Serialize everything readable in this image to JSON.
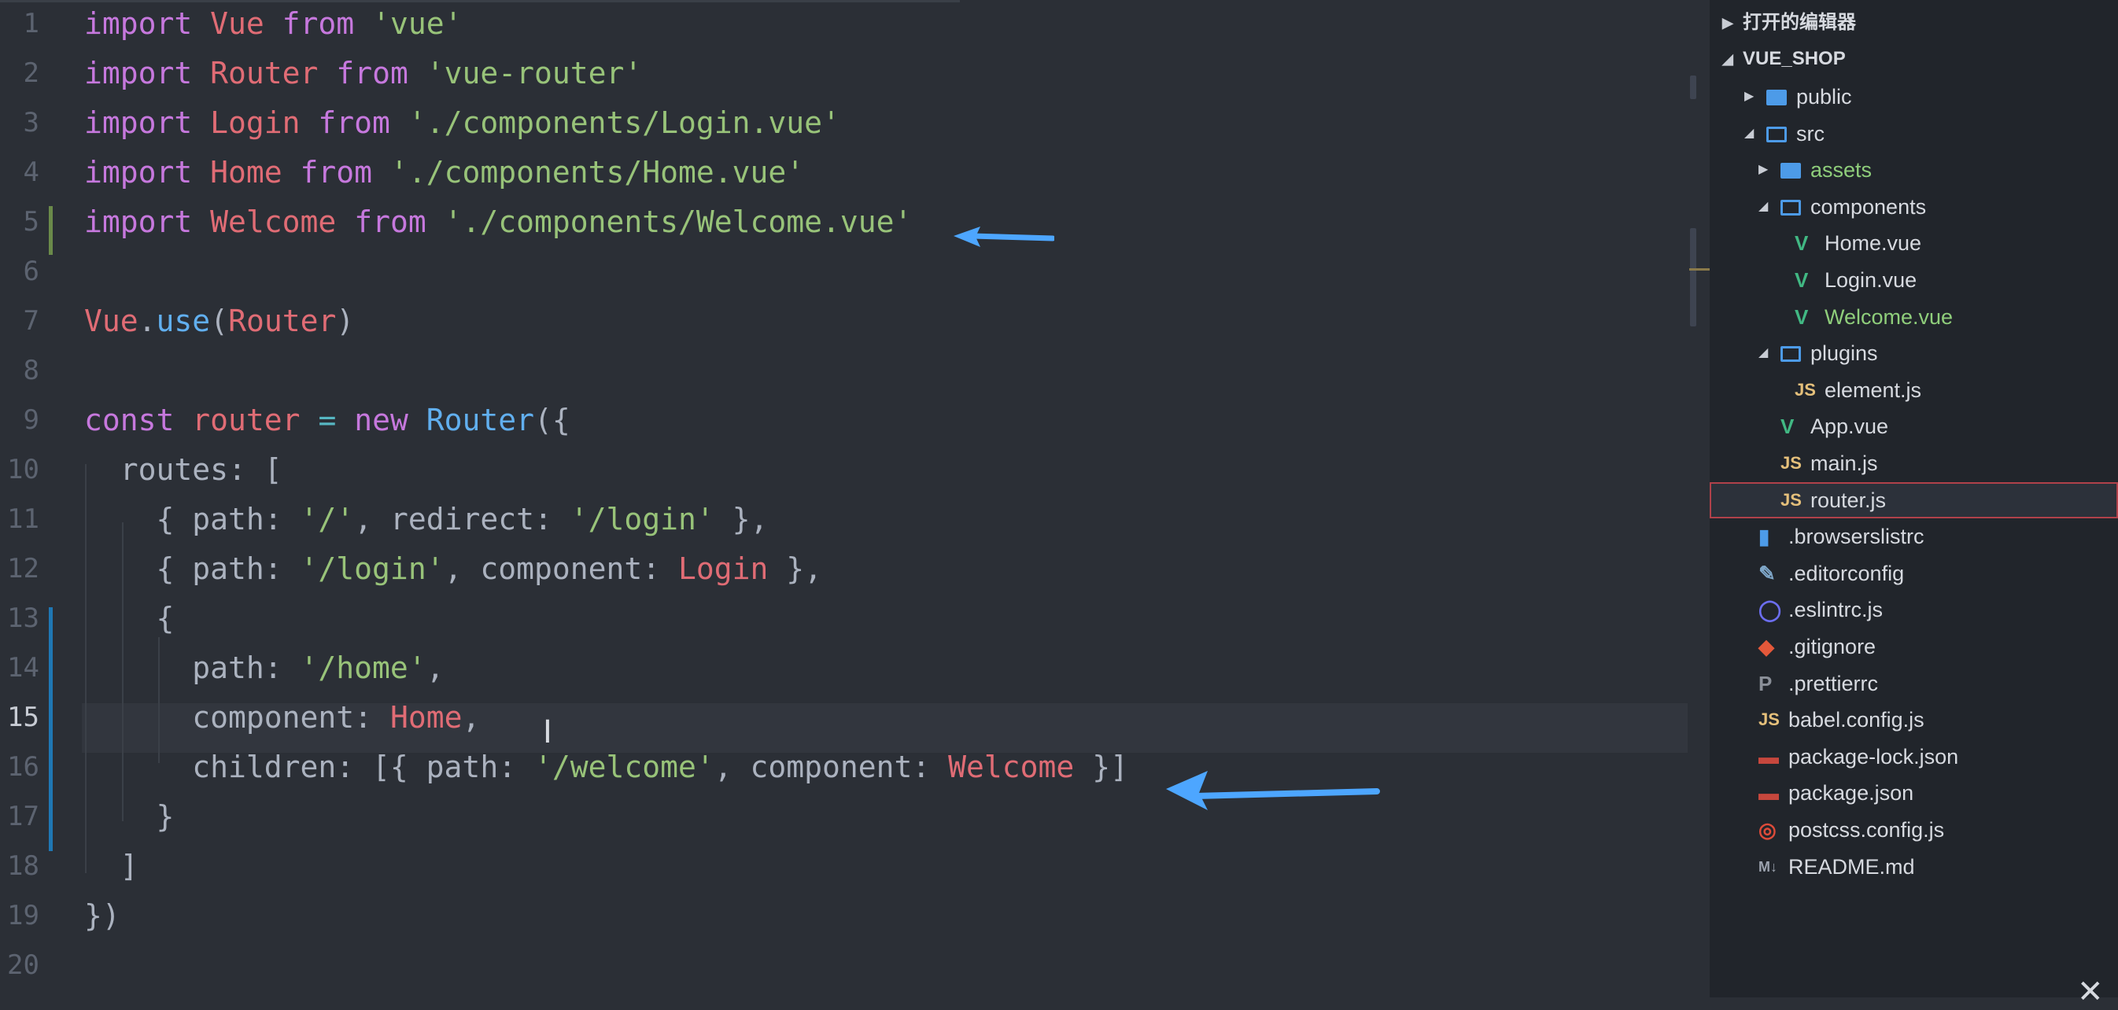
{
  "editor": {
    "active_line": "15",
    "lines": [
      {
        "n": "1",
        "tokens": [
          [
            "kw",
            "import "
          ],
          [
            "id",
            "Vue"
          ],
          [
            "kw",
            " from "
          ],
          [
            "str",
            "'vue'"
          ]
        ]
      },
      {
        "n": "2",
        "tokens": [
          [
            "kw",
            "import "
          ],
          [
            "id",
            "Router"
          ],
          [
            "kw",
            " from "
          ],
          [
            "str",
            "'vue-router'"
          ]
        ]
      },
      {
        "n": "3",
        "tokens": [
          [
            "kw",
            "import "
          ],
          [
            "id",
            "Login"
          ],
          [
            "kw",
            " from "
          ],
          [
            "str",
            "'./components/Login.vue'"
          ]
        ]
      },
      {
        "n": "4",
        "tokens": [
          [
            "kw",
            "import "
          ],
          [
            "id",
            "Home"
          ],
          [
            "kw",
            " from "
          ],
          [
            "str",
            "'./components/Home.vue'"
          ]
        ]
      },
      {
        "n": "5",
        "tokens": [
          [
            "kw",
            "import "
          ],
          [
            "id",
            "Welcome"
          ],
          [
            "kw",
            " from "
          ],
          [
            "str",
            "'./components/Welcome.vue'"
          ]
        ]
      },
      {
        "n": "6",
        "tokens": []
      },
      {
        "n": "7",
        "tokens": [
          [
            "id",
            "Vue"
          ],
          [
            "plain",
            "."
          ],
          [
            "fn",
            "use"
          ],
          [
            "plain",
            "("
          ],
          [
            "id",
            "Router"
          ],
          [
            "plain",
            ")"
          ]
        ]
      },
      {
        "n": "8",
        "tokens": []
      },
      {
        "n": "9",
        "tokens": [
          [
            "kw",
            "const "
          ],
          [
            "id",
            "router"
          ],
          [
            "cyan",
            " = "
          ],
          [
            "kw",
            "new "
          ],
          [
            "fn",
            "Router"
          ],
          [
            "plain",
            "({"
          ]
        ]
      },
      {
        "n": "10",
        "tokens": [
          [
            "plain",
            "  routes: ["
          ]
        ]
      },
      {
        "n": "11",
        "tokens": [
          [
            "plain",
            "    { path: "
          ],
          [
            "str",
            "'/'"
          ],
          [
            "plain",
            ", redirect: "
          ],
          [
            "str",
            "'/login'"
          ],
          [
            "plain",
            " },"
          ]
        ]
      },
      {
        "n": "12",
        "tokens": [
          [
            "plain",
            "    { path: "
          ],
          [
            "str",
            "'/login'"
          ],
          [
            "plain",
            ", component: "
          ],
          [
            "id",
            "Login"
          ],
          [
            "plain",
            " },"
          ]
        ]
      },
      {
        "n": "13",
        "tokens": [
          [
            "plain",
            "    {"
          ]
        ]
      },
      {
        "n": "14",
        "tokens": [
          [
            "plain",
            "      path: "
          ],
          [
            "str",
            "'/home'"
          ],
          [
            "plain",
            ","
          ]
        ]
      },
      {
        "n": "15",
        "tokens": [
          [
            "plain",
            "      component: "
          ],
          [
            "id",
            "Home"
          ],
          [
            "plain",
            ","
          ]
        ]
      },
      {
        "n": "16",
        "tokens": [
          [
            "plain",
            "      children: [{ path: "
          ],
          [
            "str",
            "'/welcome'"
          ],
          [
            "plain",
            ", component: "
          ],
          [
            "id",
            "Welcome"
          ],
          [
            "plain",
            " }]"
          ]
        ]
      },
      {
        "n": "17",
        "tokens": [
          [
            "plain",
            "    }"
          ]
        ]
      },
      {
        "n": "18",
        "tokens": [
          [
            "plain",
            "  ]"
          ]
        ]
      },
      {
        "n": "19",
        "tokens": [
          [
            "plain",
            "})"
          ]
        ]
      },
      {
        "n": "20",
        "tokens": []
      }
    ]
  },
  "explorer": {
    "open_editors_label": "打开的编辑器",
    "project_label": "VUE_SHOP",
    "items": [
      {
        "name": "public",
        "type": "folder-closed",
        "depth": 1,
        "twisty": "▶"
      },
      {
        "name": "src",
        "type": "folder-open",
        "depth": 1,
        "twisty": "◢"
      },
      {
        "name": "assets",
        "type": "folder-closed",
        "depth": 2,
        "twisty": "▶",
        "green": true
      },
      {
        "name": "components",
        "type": "folder-open",
        "depth": 2,
        "twisty": "◢"
      },
      {
        "name": "Home.vue",
        "type": "vue",
        "depth": 3
      },
      {
        "name": "Login.vue",
        "type": "vue",
        "depth": 3
      },
      {
        "name": "Welcome.vue",
        "type": "vue",
        "depth": 3,
        "green": true
      },
      {
        "name": "plugins",
        "type": "folder-open",
        "depth": 2,
        "twisty": "◢"
      },
      {
        "name": "element.js",
        "type": "js",
        "depth": 3
      },
      {
        "name": "App.vue",
        "type": "vue",
        "depth": 2
      },
      {
        "name": "main.js",
        "type": "js",
        "depth": 2
      },
      {
        "name": "router.js",
        "type": "js",
        "depth": 2,
        "selected": true
      },
      {
        "name": ".browserslistrc",
        "type": "file",
        "depth": 1
      },
      {
        "name": ".editorconfig",
        "type": "editorconfig",
        "depth": 1
      },
      {
        "name": ".eslintrc.js",
        "type": "eslint",
        "depth": 1
      },
      {
        "name": ".gitignore",
        "type": "git",
        "depth": 1
      },
      {
        "name": ".prettierrc",
        "type": "prettier",
        "depth": 1
      },
      {
        "name": "babel.config.js",
        "type": "js",
        "depth": 1
      },
      {
        "name": "package-lock.json",
        "type": "npm",
        "depth": 1
      },
      {
        "name": "package.json",
        "type": "npm",
        "depth": 1
      },
      {
        "name": "postcss.config.js",
        "type": "postcss",
        "depth": 1
      },
      {
        "name": "README.md",
        "type": "md",
        "depth": 1
      }
    ]
  },
  "icons": {
    "vue": "V",
    "js": "JS",
    "md": "M↓"
  },
  "colors": {
    "accent_arrow": "#4da6ff",
    "selection_border": "#b0414a"
  }
}
